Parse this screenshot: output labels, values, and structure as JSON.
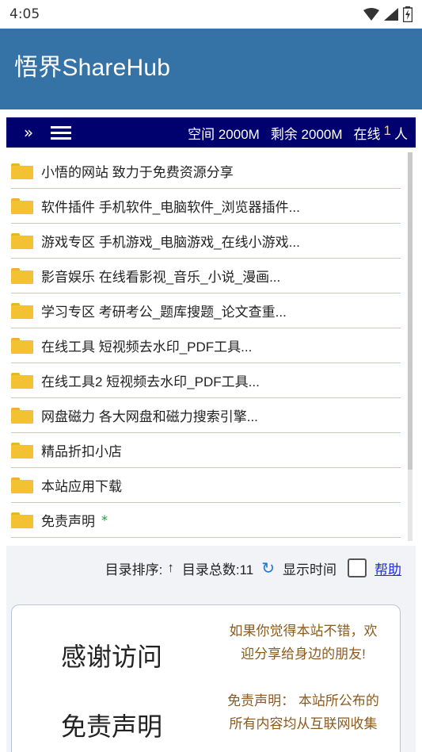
{
  "status_bar": {
    "time": "4:05",
    "icons": [
      "wifi-icon",
      "signal-icon",
      "battery-icon"
    ]
  },
  "app_bar": {
    "title": "悟界ShareHub"
  },
  "nav_bar": {
    "chevron_icon": "double-chevron-right-icon",
    "menu_icon": "hamburger-menu-icon",
    "space_label": "空间 2000M",
    "remaining_label": "剩余 2000M",
    "online_prefix": "在线",
    "online_count": "1",
    "online_suffix": "人"
  },
  "folders": [
    {
      "label": "小悟的网站 致力于免费资源分享"
    },
    {
      "label": "软件插件 手机软件_电脑软件_浏览器插件..."
    },
    {
      "label": "游戏专区 手机游戏_电脑游戏_在线小游戏..."
    },
    {
      "label": "影音娱乐 在线看影视_音乐_小说_漫画..."
    },
    {
      "label": "学习专区 考研考公_题库搜题_论文查重..."
    },
    {
      "label": "在线工具 短视频去水印_PDF工具..."
    },
    {
      "label": "在线工具2 短视频去水印_PDF工具..."
    },
    {
      "label": "网盘磁力 各大网盘和磁力搜索引擎..."
    },
    {
      "label": "精品折扣小店"
    },
    {
      "label": "本站应用下载"
    },
    {
      "label": "免责声明",
      "badge": "*"
    }
  ],
  "toolbar": {
    "sort_label": "目录排序:",
    "sort_icon": "↑",
    "count_label": "目录总数:11",
    "refresh_icon": "↻",
    "show_time_label": "显示时间",
    "help_label": "帮助"
  },
  "info_card": {
    "thanks_title": "感谢访问",
    "thanks_text_line1": "如果你觉得本站不错，欢",
    "thanks_text_line2": "迎分享给身边的朋友!",
    "disclaimer_title": "免责声明",
    "disclaimer_text_line1": "免责声明： 本站所公布的",
    "disclaimer_text_line2": "所有内容均从互联网收集",
    "colors": {
      "text_accent": "#8a5a1e"
    }
  },
  "colors": {
    "app_bar": "#3572a5",
    "nav_bar": "#00006f",
    "folder": "#f3c232",
    "divider": "#9fe3b6",
    "link": "#1f2fd6",
    "online_count": "#ffd84a"
  }
}
